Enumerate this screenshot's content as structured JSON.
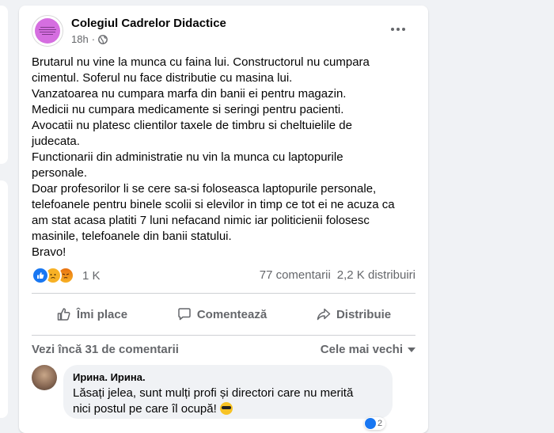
{
  "post": {
    "page_name": "Colegiul Cadrelor Didactice",
    "time": "18h",
    "separator": "·",
    "lines": [
      "Brutarul nu vine la munca cu faina lui. Constructorul nu cumpara",
      "cimentul. Soferul nu face distributie cu masina lui.",
      "Vanzatoarea nu cumpara marfa din banii ei pentru magazin.",
      "Medicii nu cumpara medicamente si seringi pentru pacienti.",
      "Avocatii nu platesc clientilor taxele de timbru si cheltuielile de",
      "judecata.",
      "Functionarii din administratie nu vin la munca cu laptopurile",
      "personale.",
      "Doar profesorilor li se cere sa-si foloseasca laptopurile personale,",
      "telefoanele pentru binele scolii si elevilor in timp ce tot ei ne acuza ca",
      "am stat acasa platiti 7 luni nefacand nimic iar politicienii folosesc",
      "masinile, telefoanele din banii statului.",
      "Bravo!"
    ]
  },
  "stats": {
    "reactions_count": "1 K",
    "comments": "77 comentarii",
    "shares": "2,2 K distribuiri"
  },
  "actions": {
    "like": "Îmi place",
    "comment": "Comentează",
    "share": "Distribuie"
  },
  "comments_bar": {
    "view_more": "Vezi încă 31 de comentarii",
    "sort": "Cele mai vechi"
  },
  "comment": {
    "author": "Иpина. Ирина.",
    "lines": [
      "Lăsați jelea, sunt mulți profi și directori care nu merită",
      "nici postul pe care îl ocupă!"
    ],
    "reaction_count": "2"
  },
  "colors": {
    "accent": "#1877f2",
    "secondary_text": "#65676b",
    "background": "#f0f2f5"
  }
}
